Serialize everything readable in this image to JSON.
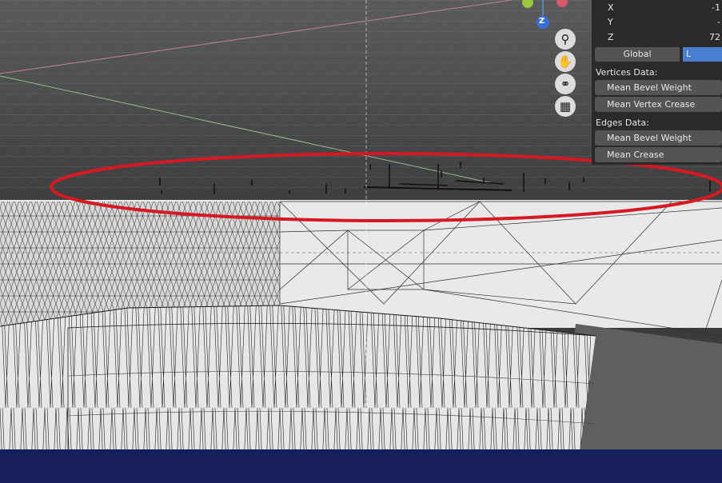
{
  "npanel": {
    "x_label": "X",
    "x_value": "-1",
    "y_label": "Y",
    "y_value": "-",
    "z_label": "Z",
    "z_value": "72",
    "orientation": {
      "global_label": "Global",
      "local_label": "L"
    },
    "vertices_section": "Vertices Data:",
    "vertex_buttons": [
      "Mean Bevel Weight",
      "Mean Vertex Crease"
    ],
    "edges_section": "Edges Data:",
    "edge_buttons": [
      "Mean Bevel Weight",
      "Mean Crease"
    ]
  },
  "gizmo": {
    "axis_label": "Z",
    "icons": [
      "zoom-icon",
      "hand-pan-icon",
      "camera-icon",
      "grid-perspective-icon"
    ]
  },
  "colors": {
    "annotation_ellipse": "#d81820",
    "panel_bg": "#2a2a2a",
    "active_toggle": "#4a7fd0",
    "mesh_fill": "#e8e8e8",
    "bottom_bar": "#161f5a"
  }
}
